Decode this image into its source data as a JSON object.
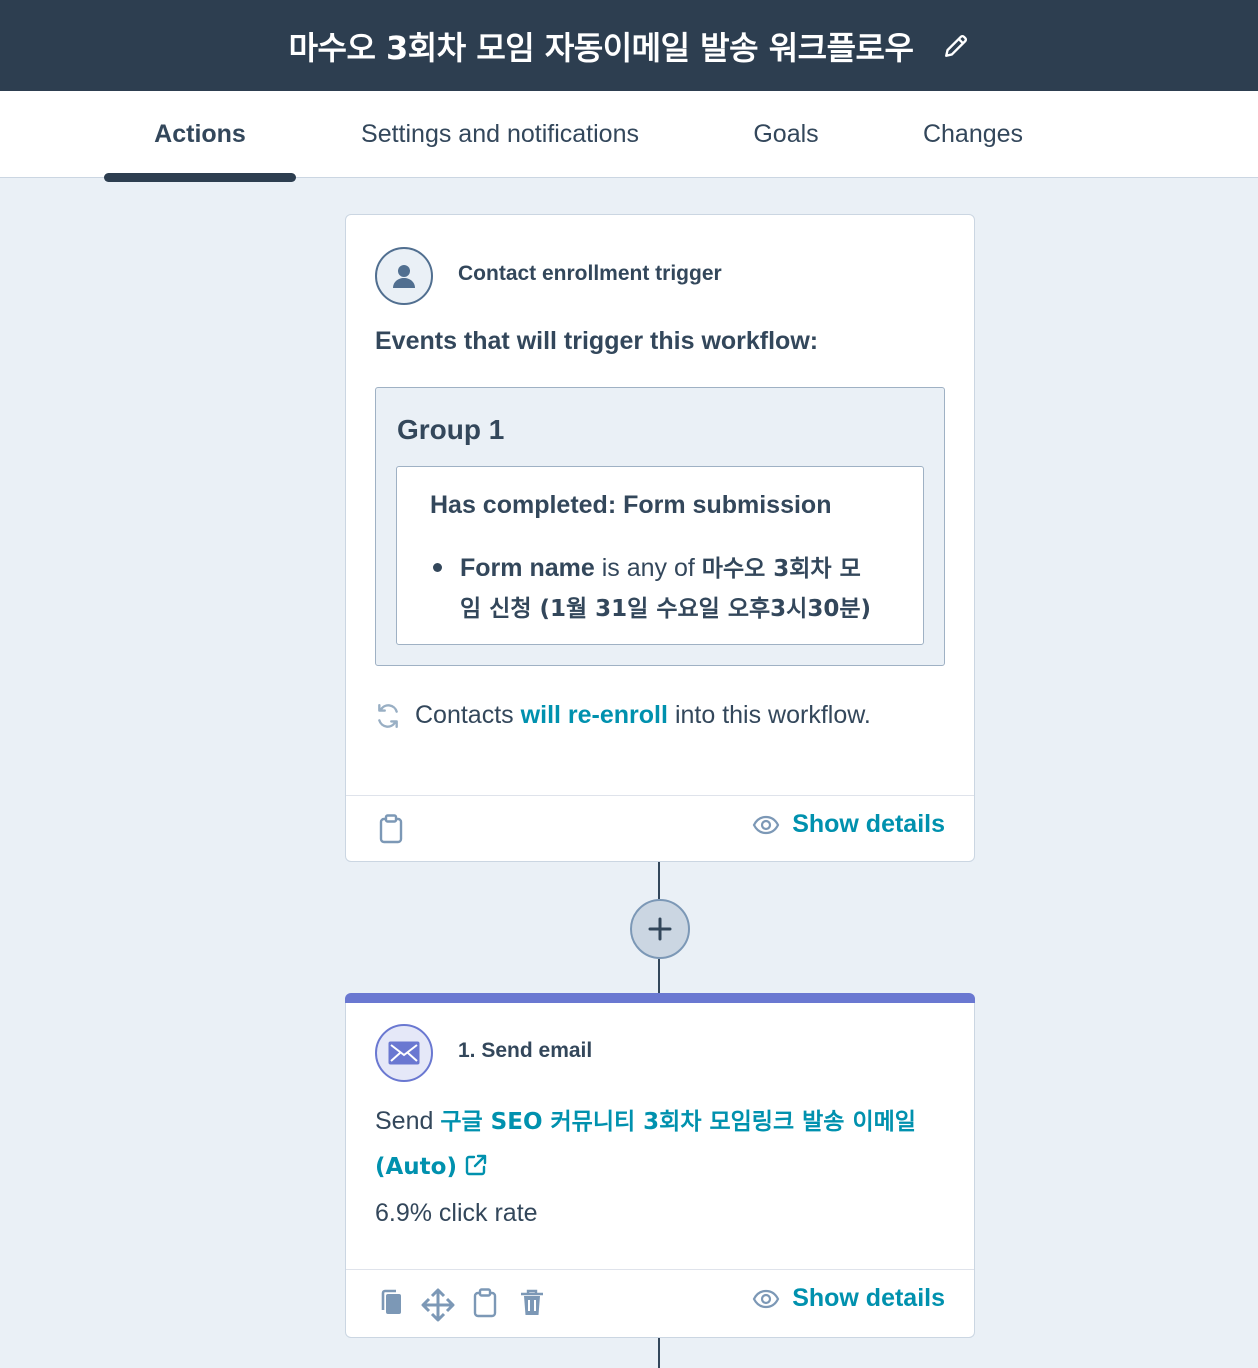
{
  "header": {
    "workflow_title": "마수오 3회차 모임 자동이메일 발송 워크플로우",
    "edit_icon": "pencil-icon"
  },
  "tabs": [
    {
      "label": "Actions",
      "active": true
    },
    {
      "label": "Settings and notifications",
      "active": false
    },
    {
      "label": "Goals",
      "active": false
    },
    {
      "label": "Changes",
      "active": false
    }
  ],
  "trigger_card": {
    "label": "Contact enrollment trigger",
    "icon": "contact-avatar-icon",
    "events_heading": "Events that will trigger this workflow:",
    "group": {
      "title": "Group 1",
      "filter_heading": "Has completed: Form submission",
      "filter_property": "Form name",
      "filter_operator": "is any of",
      "filter_value_line1": "마수오 3회차 모",
      "filter_value_line2": "임 신청 (1월 31일 수요일 오후3시30분)"
    },
    "reenroll_prefix": "Contacts",
    "reenroll_link": "will re-enroll",
    "reenroll_suffix": "into this workflow.",
    "show_details": "Show details"
  },
  "add_action": {
    "icon": "plus-icon"
  },
  "action_card": {
    "label": "1. Send email",
    "icon": "envelope-icon",
    "send_prefix": "Send",
    "email_name": "구글 SEO 커뮤니티 3회차 모임링크 발송 이메일 (Auto)",
    "click_rate": "6.9% click rate",
    "show_details": "Show details",
    "accent_color": "#6a78d1"
  },
  "colors": {
    "header_bg": "#2d3e50",
    "link": "#0091ae",
    "canvas_bg": "#eaf0f6"
  }
}
